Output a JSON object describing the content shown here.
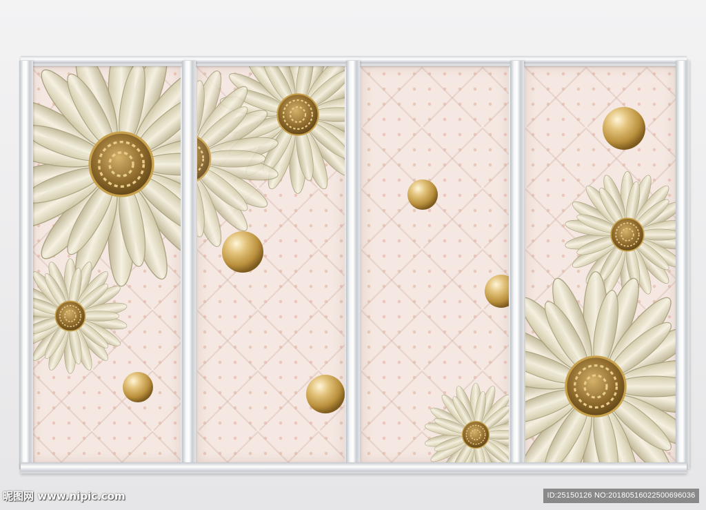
{
  "image": {
    "subject": "",
    "panels": 4
  },
  "watermark": {
    "site_text": "昵图网 www.nipic.com",
    "id_text": "ID:25150126 NO:20180516022500696036"
  },
  "colors": {
    "background": "#eeeeef",
    "panel": "#f5e8e2",
    "frame": "#d8dbdf",
    "pearl": "#c9a45a",
    "petal": "#e6dfc7",
    "flower_center": "#8a6a2a"
  },
  "icons": {
    "flower": "daisy-flower-icon",
    "pearl": "pearl-sphere-icon"
  }
}
